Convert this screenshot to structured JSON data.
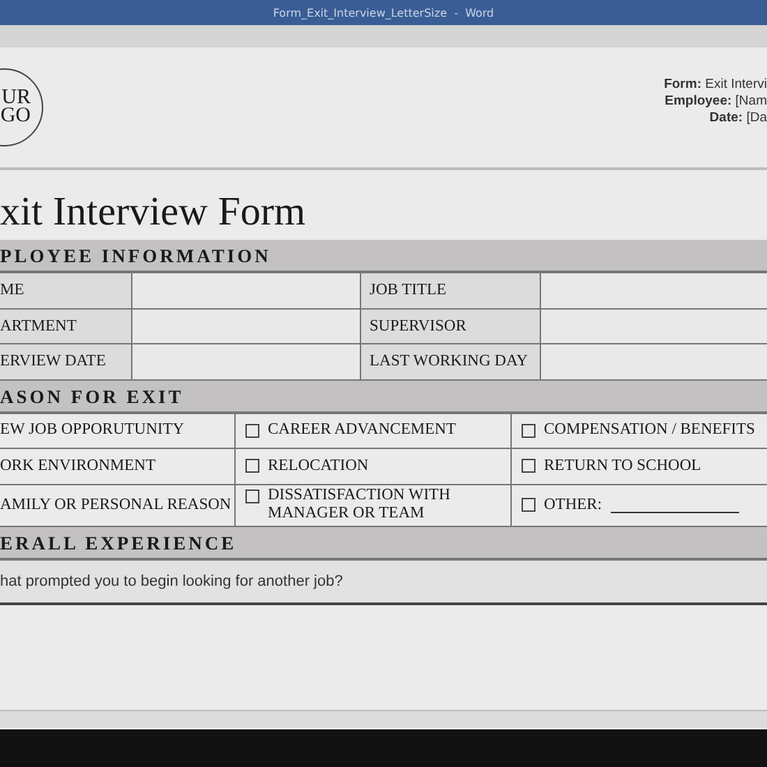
{
  "window": {
    "title": "Form_Exit_Interview_LetterSize  -  Word"
  },
  "header": {
    "logo_lines": [
      "UR",
      "GO"
    ],
    "meta": [
      {
        "label": "Form:",
        "value": "Exit Intervi"
      },
      {
        "label": "Employee:",
        "value": "[Nam"
      },
      {
        "label": "Date:",
        "value": "[Da"
      }
    ]
  },
  "title": "xit Interview Form",
  "employee_section": {
    "heading": "PLOYEE INFORMATION",
    "rows": [
      {
        "label_1": "ME",
        "label_2": "JOB TITLE"
      },
      {
        "label_1": "ARTMENT",
        "label_2": "SUPERVISOR"
      },
      {
        "label_1": "ERVIEW DATE",
        "label_2": "LAST WORKING DAY"
      }
    ]
  },
  "reason_section": {
    "heading": "ASON FOR EXIT",
    "rows": [
      [
        {
          "label": "EW JOB OPPORUTUNITY"
        },
        {
          "label": "CAREER ADVANCEMENT",
          "checked": false
        },
        {
          "label": "COMPENSATION / BENEFITS",
          "checked": false
        }
      ],
      [
        {
          "label": "ORK ENVIRONMENT"
        },
        {
          "label": "RELOCATION",
          "checked": false
        },
        {
          "label": "RETURN TO SCHOOL",
          "checked": false
        }
      ],
      [
        {
          "label": "AMILY OR PERSONAL REASON"
        },
        {
          "label": "DISSATISFACTION WITH MANAGER OR TEAM",
          "checked": false
        },
        {
          "label": "OTHER:",
          "checked": false,
          "kind": "other"
        }
      ]
    ]
  },
  "experience_section": {
    "heading": "ERALL EXPERIENCE",
    "question": "hat prompted you to begin looking for another job?"
  }
}
